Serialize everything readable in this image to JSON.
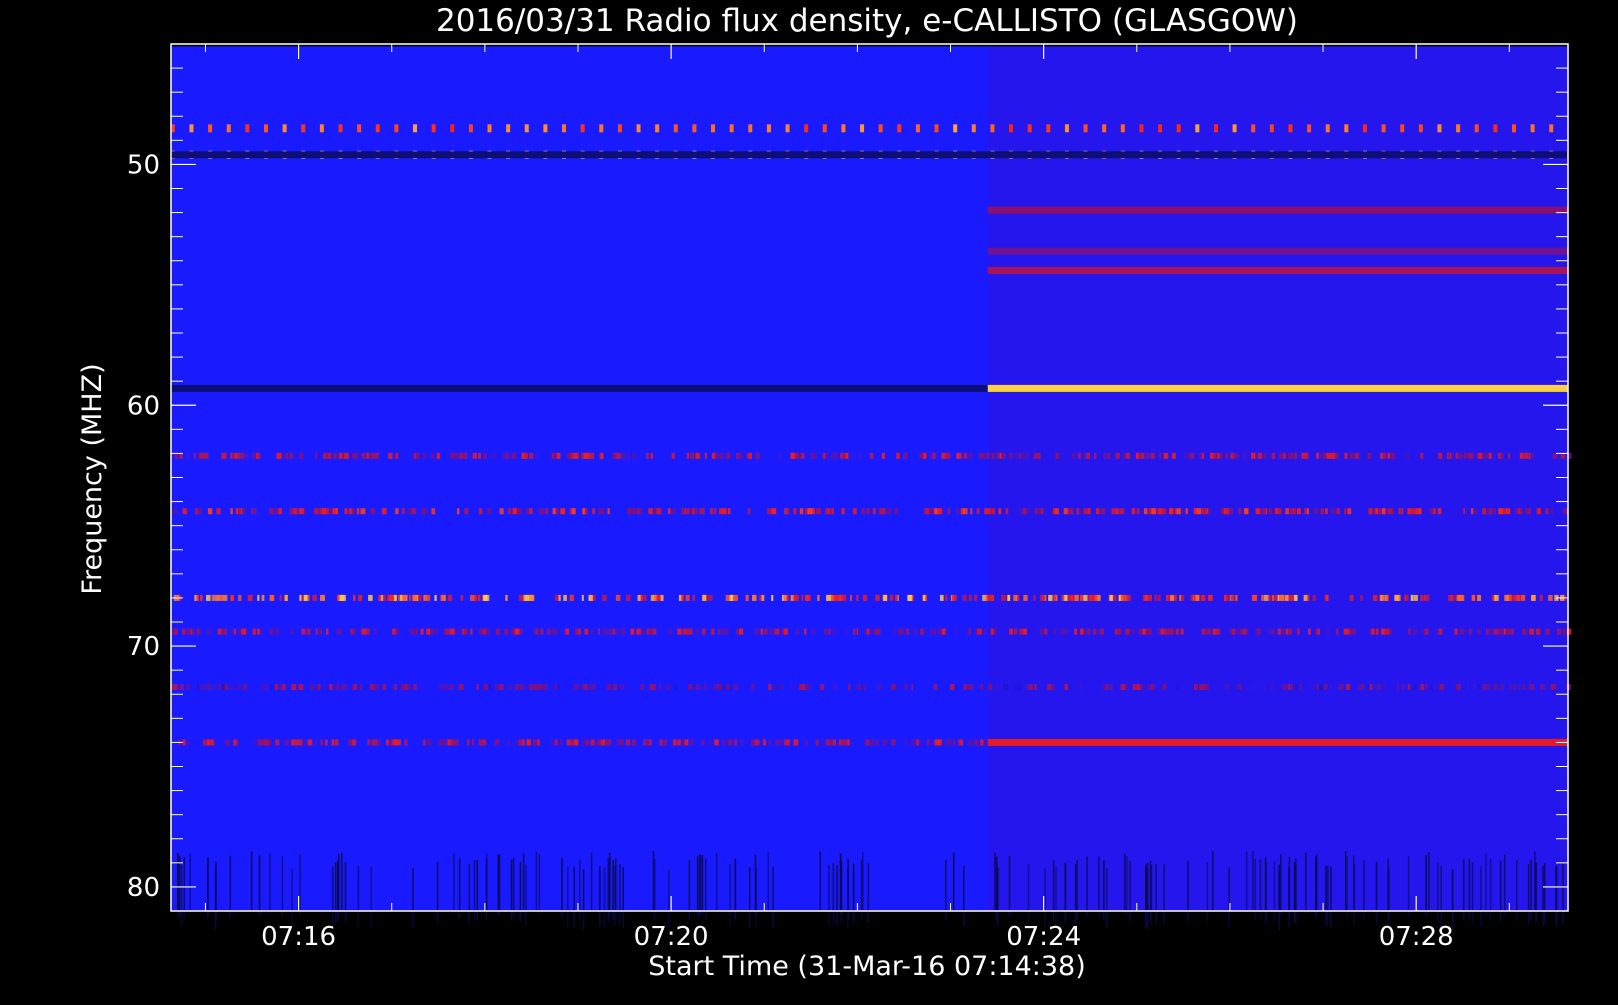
{
  "chart_data": {
    "type": "heatmap",
    "title": "2016/03/31  Radio flux density, e-CALLISTO (GLASGOW)",
    "xlabel": "Start Time (31-Mar-16 07:14:38)",
    "ylabel": "Frequency (MHZ)",
    "x_unit": "minutes of day (UT)",
    "xlim": [
      434.63,
      449.63
    ],
    "ylim": [
      81,
      45
    ],
    "y_axis_inverted": true,
    "x_ticks": [
      {
        "value": 436,
        "label": "07:16"
      },
      {
        "value": 440,
        "label": "07:20"
      },
      {
        "value": 444,
        "label": "07:24"
      },
      {
        "value": 448,
        "label": "07:28"
      }
    ],
    "y_ticks": [
      {
        "value": 50,
        "label": "50"
      },
      {
        "value": 60,
        "label": "60"
      },
      {
        "value": 70,
        "label": "70"
      },
      {
        "value": 80,
        "label": "80"
      }
    ],
    "data_time_range": [
      434.63,
      449.63
    ],
    "data_freq_range": [
      45.1,
      81.0
    ],
    "colormap": [
      "#0a0a4a",
      "#1a1aff",
      "#8a1070",
      "#ff2010",
      "#ffd040",
      "#ffffff"
    ],
    "background_color": "#1a1aff",
    "step_change_time": 443.4,
    "bands": [
      {
        "freq": 48.5,
        "t0": 434.63,
        "t1": 449.63,
        "kind": "pulses",
        "level": 0.75
      },
      {
        "freq": 49.6,
        "t0": 434.63,
        "t1": 449.63,
        "kind": "pulses",
        "level": 0.9
      },
      {
        "freq": 49.6,
        "t0": 434.63,
        "t1": 449.63,
        "kind": "line",
        "level": 0.05
      },
      {
        "freq": 59.3,
        "t0": 434.63,
        "t1": 443.4,
        "kind": "line",
        "level": 0.05
      },
      {
        "freq": 59.3,
        "t0": 443.4,
        "t1": 449.63,
        "kind": "line",
        "level": 0.8
      },
      {
        "freq": 62.1,
        "t0": 434.63,
        "t1": 449.63,
        "kind": "speckle",
        "level": 0.5
      },
      {
        "freq": 64.4,
        "t0": 434.63,
        "t1": 449.63,
        "kind": "speckle",
        "level": 0.55
      },
      {
        "freq": 68.0,
        "t0": 434.63,
        "t1": 449.63,
        "kind": "speckle",
        "level": 0.72
      },
      {
        "freq": 69.4,
        "t0": 434.63,
        "t1": 449.63,
        "kind": "speckle",
        "level": 0.5
      },
      {
        "freq": 71.7,
        "t0": 434.63,
        "t1": 449.63,
        "kind": "speckle",
        "level": 0.4
      },
      {
        "freq": 74.0,
        "t0": 434.63,
        "t1": 449.63,
        "kind": "speckle",
        "level": 0.5
      },
      {
        "freq": 74.0,
        "t0": 443.4,
        "t1": 449.63,
        "kind": "line",
        "level": 0.55
      },
      {
        "freq": 51.9,
        "t0": 443.4,
        "t1": 449.63,
        "kind": "line",
        "level": 0.4
      },
      {
        "freq": 53.6,
        "t0": 443.4,
        "t1": 449.63,
        "kind": "line",
        "level": 0.35
      },
      {
        "freq": 54.4,
        "t0": 443.4,
        "t1": 449.63,
        "kind": "line",
        "level": 0.45
      }
    ]
  }
}
